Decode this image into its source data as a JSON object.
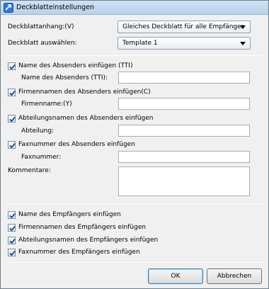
{
  "window": {
    "title": "Deckblatteinstellungen"
  },
  "fields": {
    "anhang_label": "Deckblattanhang:(V)",
    "anhang_value": "Gleiches Deckblatt für alle Empfänger",
    "auswahl_label": "Deckblatt auswählen:",
    "auswahl_value": "Template 1"
  },
  "sender": {
    "name_checkbox": "Name des Absenders einfügen (TTI)",
    "name_label": "Name des Absenders (TTI):",
    "firma_checkbox": "Firmennamen des Absenders einfügen(C)",
    "firma_label": "Firmenname:(Y)",
    "abteilung_checkbox": "Abteilungsnamen des Absenders einfügen",
    "abteilung_label": "Abteilung:",
    "fax_checkbox": "Faxnummer des Absenders einfügen",
    "fax_label": "Faxnummer:"
  },
  "comments": {
    "label": "Kommentare:"
  },
  "recipient": {
    "name_checkbox": "Name des Empfängers einfügen",
    "firma_checkbox": "Firmennamen des Empfängers einfügen",
    "abteilung_checkbox": "Abteilungsnamen des Empfängers einfügen",
    "fax_checkbox": "Faxnummer des Empfängers einfügen"
  },
  "buttons": {
    "ok": "OK",
    "cancel": "Abbrechen"
  },
  "icons": {
    "title": "dialog-app-icon",
    "check": "check-icon",
    "dropdown": "chevron-down-icon"
  },
  "colors": {
    "titlebar": "#b9d1ea",
    "default_button_border": "#3c7fb1"
  }
}
